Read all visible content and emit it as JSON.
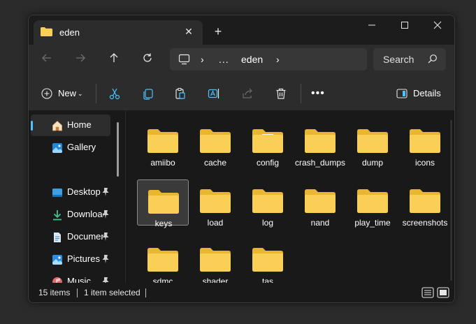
{
  "tab": {
    "title": "eden"
  },
  "address": {
    "path": [
      "...",
      "eden"
    ]
  },
  "search": {
    "placeholder": "Search"
  },
  "toolbar": {
    "new_label": "New",
    "details_label": "Details"
  },
  "sidebar": {
    "items": [
      {
        "label": "Home"
      },
      {
        "label": "Gallery"
      },
      {
        "label": "Desktop"
      },
      {
        "label": "Downloads"
      },
      {
        "label": "Documents"
      },
      {
        "label": "Pictures"
      },
      {
        "label": "Music"
      }
    ]
  },
  "files": [
    {
      "name": "amiibo"
    },
    {
      "name": "cache"
    },
    {
      "name": "config"
    },
    {
      "name": "crash_dumps"
    },
    {
      "name": "dump"
    },
    {
      "name": "icons"
    },
    {
      "name": "keys"
    },
    {
      "name": "load"
    },
    {
      "name": "log"
    },
    {
      "name": "nand"
    },
    {
      "name": "play_time"
    },
    {
      "name": "screenshots"
    },
    {
      "name": "sdmc"
    },
    {
      "name": "shader"
    },
    {
      "name": "tas"
    }
  ],
  "status": {
    "item_count": "15 items",
    "selection": "1 item selected"
  },
  "colors": {
    "folder": "#f9cf55",
    "folder_back": "#e8b631",
    "accent": "#4cc2ff"
  }
}
